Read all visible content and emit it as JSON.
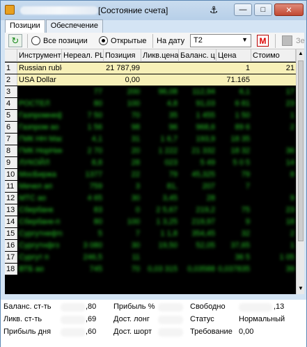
{
  "window": {
    "title": "[Состояние счета]",
    "buttons": {
      "anchor": "⚓",
      "minimize": "—",
      "maximize": "□",
      "close": "✕"
    }
  },
  "tabs": [
    {
      "label": "Позиции"
    },
    {
      "label": "Обеспечение"
    }
  ],
  "toolbar": {
    "refresh_icon": "↻",
    "radio_all": "Все позиции",
    "radio_open": "Открытые",
    "date_label": "На дату",
    "date_value": "T2",
    "m_button": "M",
    "edit_label": "Зе"
  },
  "columns": [
    "",
    "Инструмент",
    "Нереал. PL",
    "Позиция",
    "Ликв.цена",
    "Баланс. ц",
    "Цена",
    "Стоимо"
  ],
  "rows": [
    {
      "n": "1",
      "name": "Russian ruble",
      "pl": "",
      "pos": "21 787,99",
      "liq": "",
      "bal": "",
      "price": "1",
      "cost": "21",
      "hl": true
    },
    {
      "n": "2",
      "name": "USA Dollar",
      "pl": "",
      "pos": "0,00",
      "liq": "",
      "bal": "",
      "price": "71.165",
      "cost": "",
      "hl": true
    },
    {
      "n": "3",
      "name": "",
      "pl": "77",
      "pos": "200",
      "liq": "96,08",
      "bal": "112,94",
      "price": "6,1",
      "cost": "17"
    },
    {
      "n": "4",
      "name": "РОСТЕЛ",
      "pl": "80",
      "pos": "100",
      "liq": "4,8",
      "bal": "91,03",
      "price": "6 81",
      "cost": "23"
    },
    {
      "n": "5",
      "name": "Газпромнефть ап",
      "pl": "7 50",
      "pos": "70",
      "liq": "35",
      "bal": "1 455",
      "price": "1 50",
      "cost": "1"
    },
    {
      "n": "6",
      "name": "Газпром ао",
      "pl": "1 56",
      "pos": "98",
      "liq": "96",
      "bal": "968,6",
      "price": "89 6",
      "cost": "2"
    },
    {
      "n": "7",
      "name": "ГМК НН Мао",
      "pl": "4,1",
      "pos": "31",
      "liq": "1 6,7",
      "bal": "193,9",
      "price": "18 35",
      "cost": ""
    },
    {
      "n": "8",
      "name": "ГМК НорНик",
      "pl": "2 70",
      "pos": "20",
      "liq": "1 222",
      "bal": "21 332",
      "price": "18 32",
      "cost": "36"
    },
    {
      "n": "9",
      "name": "ЛУКОЙЛ",
      "pl": "8,8",
      "pos": "28",
      "liq": "023",
      "bal": "5 49",
      "price": "5 0 5",
      "cost": "14"
    },
    {
      "n": "10",
      "name": "МосБиржа",
      "pl": "1377",
      "pos": "22",
      "liq": "79",
      "bal": "45,325",
      "price": "79",
      "cost": "8"
    },
    {
      "n": "11",
      "name": "Мечел ап",
      "pl": "759",
      "pos": "3",
      "liq": "81,",
      "bal": "207",
      "price": "7",
      "cost": ""
    },
    {
      "n": "12",
      "name": "МТС ао",
      "pl": "4 65",
      "pos": "30",
      "liq": "3,45",
      "bal": "28",
      "price": "",
      "cost": "9"
    },
    {
      "n": "13",
      "name": "Сбербанк",
      "pl": "83",
      "pos": "0",
      "liq": "2 5,67",
      "bal": "219,2",
      "price": "75",
      "cost": "23"
    },
    {
      "n": "14",
      "name": "Сбербанк-п",
      "pl": "80",
      "pos": "100",
      "liq": "1 3,25",
      "bal": "219,97",
      "price": "9",
      "cost": "18"
    },
    {
      "n": "15",
      "name": "Сургутнефть",
      "pl": "5",
      "pos": "7",
      "liq": "1 1,8",
      "bal": "354,45",
      "price": "32",
      "cost": "2"
    },
    {
      "n": "16",
      "name": "Сургутнфгз",
      "pl": "3 080",
      "pos": "30",
      "liq": "19,50",
      "bal": "52,05",
      "price": "37,65",
      "cost": "1"
    },
    {
      "n": "17",
      "name": "Сургут п",
      "pl": "246,5",
      "pos": "11",
      "liq": "",
      "bal": "",
      "price": "36 5",
      "cost": "1 05"
    },
    {
      "n": "18",
      "name": "ВТБ ао",
      "pl": "745",
      "pos": "70",
      "liq": "0,03 315",
      "bal": "0,03588",
      "price": "0,037835",
      "cost": "39"
    }
  ],
  "summary": {
    "balance_label": "Баланс. ст-ть",
    "balance_value": ",80",
    "liquid_label": "Ликв. ст-ть",
    "liquid_value": ",69",
    "profit_day_label": "Прибыль дня",
    "profit_day_value": ",60",
    "profit_pct_label": "Прибыль %",
    "profit_pct_value": "",
    "long_label": "Дост. лонг",
    "long_value": "",
    "short_label": "Дост. шорт",
    "short_value": "",
    "free_label": "Свободно",
    "free_value": ",13",
    "status_label": "Статус",
    "status_value": "Нормальный",
    "req_label": "Требование",
    "req_value": "0,00"
  },
  "colors": {
    "accent_green": "#28d028",
    "highlight_row": "#f7f0b8",
    "grid_bg": "#000000"
  }
}
